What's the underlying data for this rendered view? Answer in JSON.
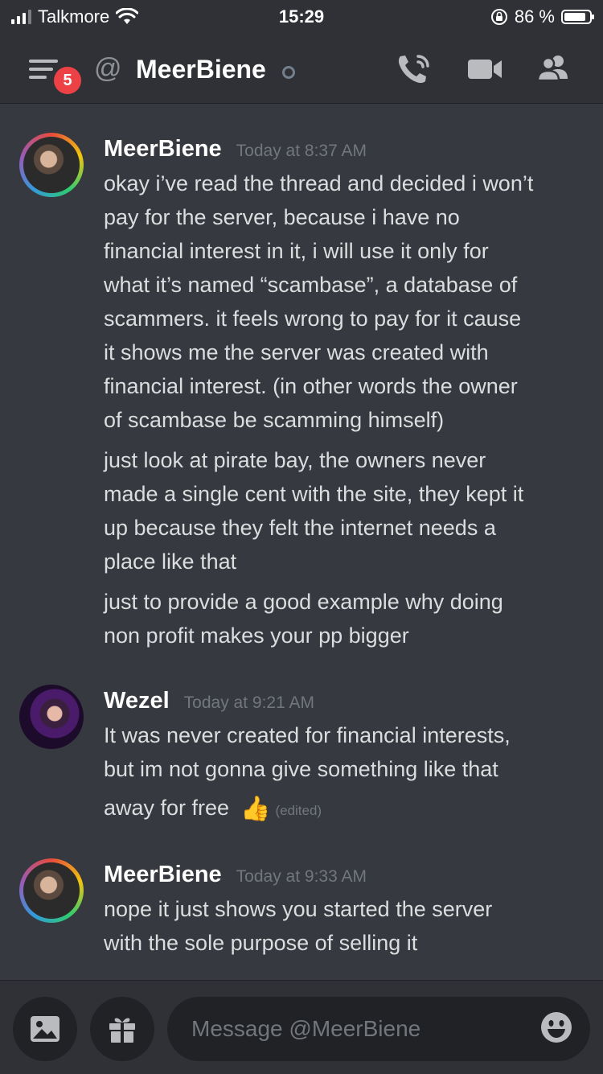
{
  "status_bar": {
    "carrier": "Talkmore",
    "time": "15:29",
    "battery_percent": "86 %",
    "battery_level": 0.86
  },
  "header": {
    "notification_count": "5",
    "at_symbol": "@",
    "channel_name": "MeerBiene",
    "icons": [
      "menu-icon",
      "at-icon",
      "call-icon",
      "video-icon",
      "members-icon"
    ]
  },
  "messages": [
    {
      "author": "MeerBiene",
      "timestamp": "Today at 8:37 AM",
      "avatar": "rainbow-ring-avatar",
      "lines": [
        "okay i’ve read the thread and decided i won’t",
        "pay for the server, because i have no",
        "financial interest in it, i will use it only for",
        "what it’s named “scambase”, a database of",
        "scammers. it feels wrong to pay for it cause",
        "it shows me the server was created with",
        "financial interest. (in other words the owner",
        "of scambase be scamming himself)",
        "",
        "just look at pirate bay, the owners never",
        "made a single cent with the site, they kept it",
        "up because they felt the internet needs a",
        "place like that",
        "",
        "just to provide a good example why doing",
        "non profit makes your pp bigger"
      ]
    },
    {
      "author": "Wezel",
      "timestamp": "Today at 9:21 AM",
      "avatar": "purple-avatar",
      "lines": [
        "It was never created for financial  interests,",
        "but im not gonna give something like that"
      ],
      "last_line": "away for free",
      "emoji": "👍",
      "edited_label": "(edited)"
    },
    {
      "author": "MeerBiene",
      "timestamp": "Today at 9:33 AM",
      "avatar": "rainbow-ring-avatar",
      "lines": [
        "nope it just shows you started the server",
        "with the sole purpose of selling it"
      ]
    }
  ],
  "composer": {
    "placeholder": "Message @MeerBiene",
    "icons": [
      "image-icon",
      "gift-icon",
      "emoji-icon"
    ]
  },
  "colors": {
    "background": "#36393f",
    "header_background": "#2f3136",
    "input_background": "#202225",
    "badge_red": "#ed4245",
    "text": "#dcddde",
    "muted": "#72767d"
  }
}
